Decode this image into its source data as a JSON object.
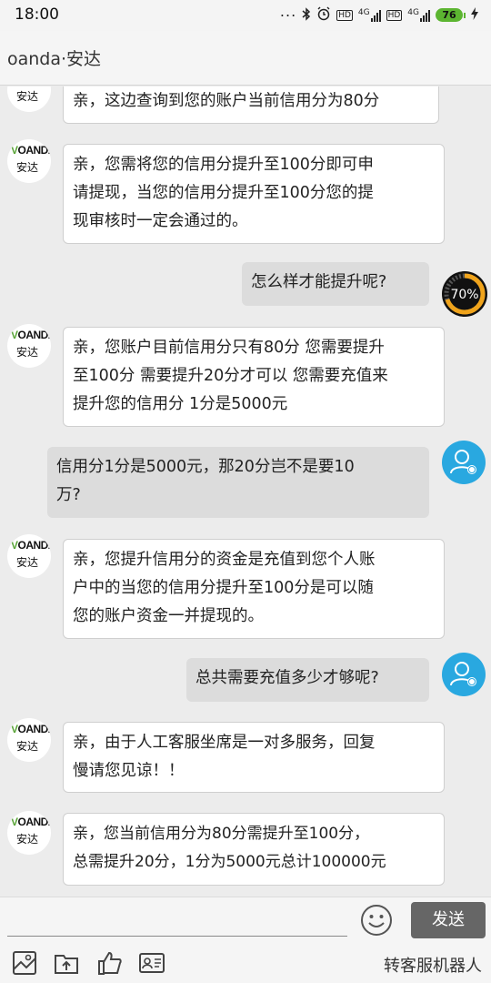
{
  "status_bar": {
    "time": "18:00",
    "dots": "...",
    "hd1": "HD",
    "net1": "4G",
    "hd2": "HD",
    "net2": "4G",
    "battery": "76"
  },
  "header": {
    "title": "oanda·安达"
  },
  "avatar": {
    "logo_line1": "OANDA",
    "logo_line2": "安达"
  },
  "messages": [
    {
      "side": "in",
      "lines": [
        "亲，这边查询到您的账户当前信用分为80分"
      ]
    },
    {
      "side": "in",
      "lines": [
        "亲，您需将您的信用分提升至100分即可申",
        "请提现，当您的信用分提升至100分您的提",
        "现审核时一定会通过的。"
      ]
    },
    {
      "side": "out",
      "lines": [
        "怎么样才能提升呢?"
      ]
    },
    {
      "side": "in",
      "lines": [
        "亲，您账户目前信用分只有80分 您需要提升",
        "至100分 需要提升20分才可以 您需要充值来",
        "提升您的信用分 1分是5000元"
      ]
    },
    {
      "side": "out",
      "lines": [
        "信用分1分是5000元，那20分岂不是要10",
        "万?"
      ]
    },
    {
      "side": "in",
      "lines": [
        "亲，您提升信用分的资金是充值到您个人账",
        "户中的当您的信用分提升至100分是可以随",
        "您的账户资金一并提现的。"
      ]
    },
    {
      "side": "out",
      "lines": [
        "总共需要充值多少才够呢?"
      ]
    },
    {
      "side": "in",
      "lines": [
        "亲，由于人工客服坐席是一对多服务，回复",
        "慢请您见谅！！"
      ]
    },
    {
      "side": "in",
      "lines": [
        "亲，您当前信用分为80分需提升至100分，",
        "总需提升20分，1分为5000元总计100000元"
      ]
    }
  ],
  "progress": {
    "label": "70%",
    "value": 0.7
  },
  "input": {
    "placeholder": "",
    "value": ""
  },
  "send_label": "发送",
  "robot_label": "转客服机器人",
  "icons": [
    "image-icon",
    "file-upload-icon",
    "thumbs-up-icon",
    "contact-card-icon",
    "emoji-icon"
  ],
  "colors": {
    "user_avatar": "#29a8e0",
    "battery": "#5cb531",
    "send_button": "#666666"
  }
}
